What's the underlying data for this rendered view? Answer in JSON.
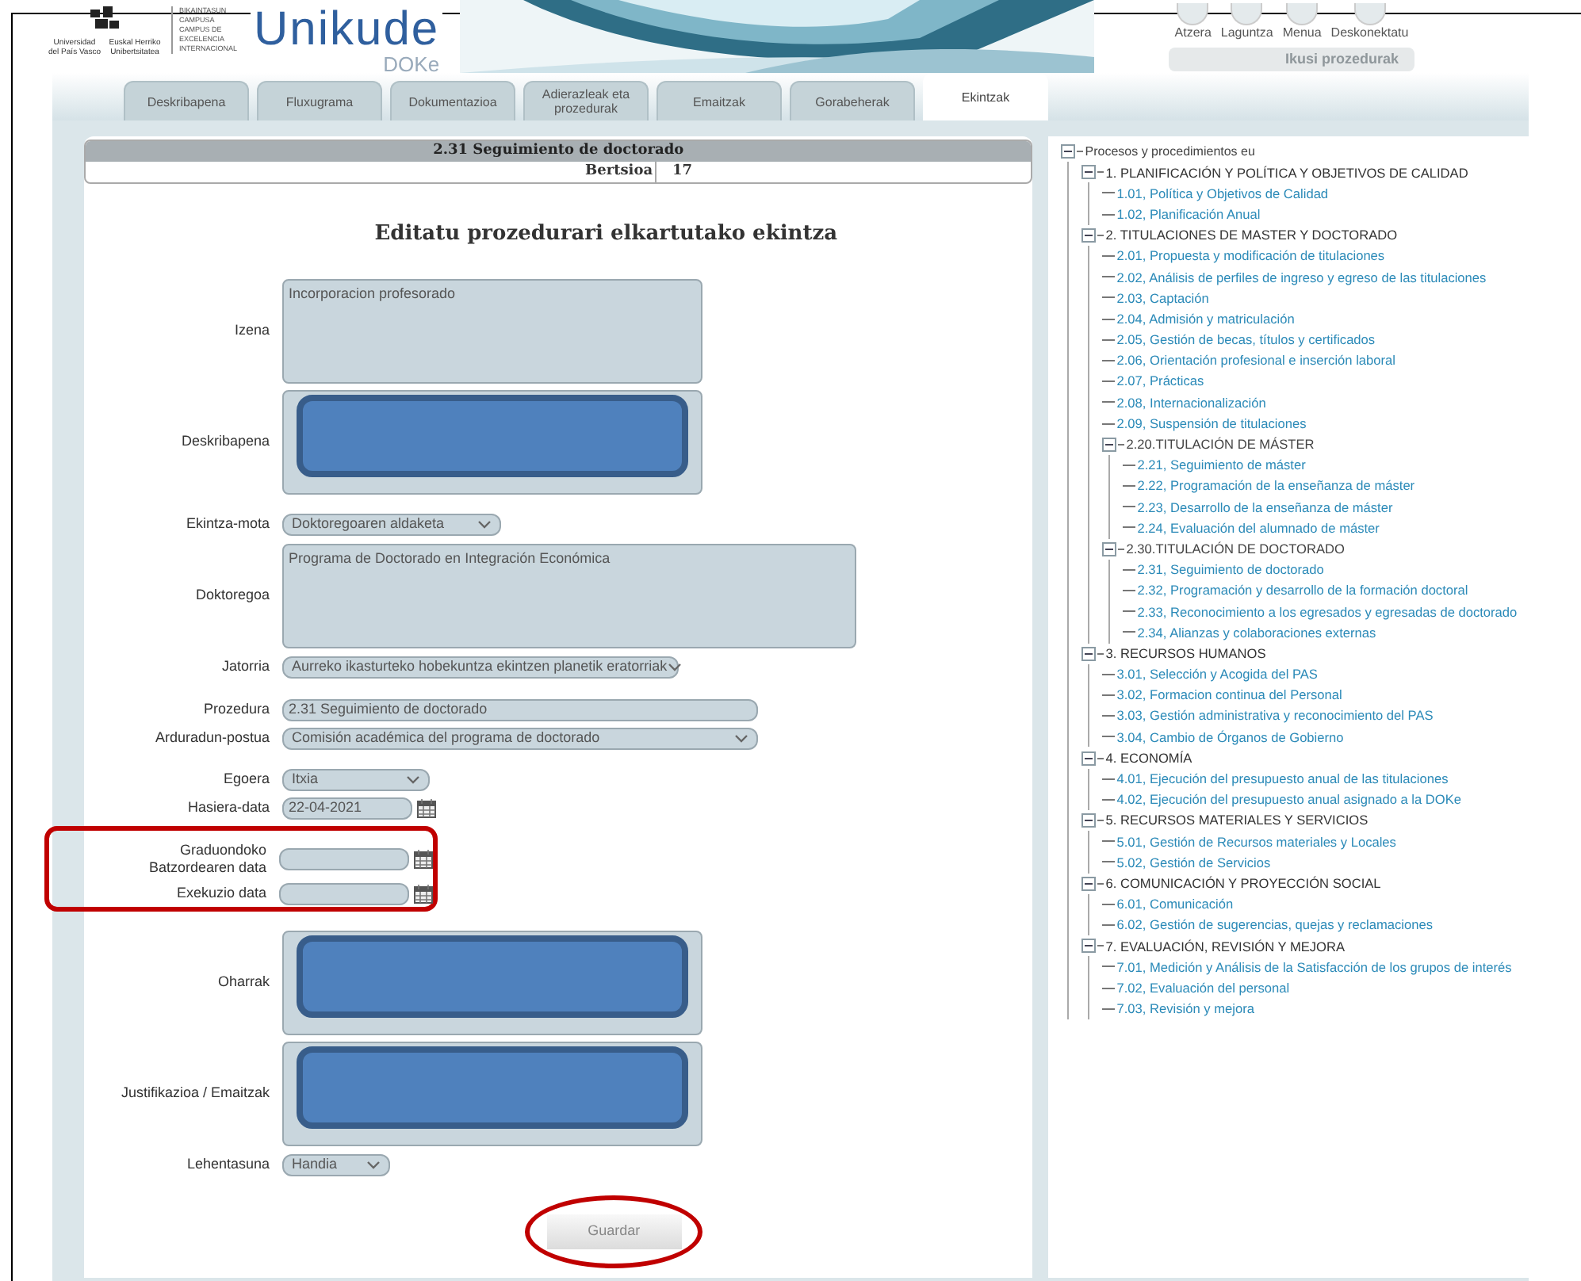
{
  "header": {
    "university": [
      "Universidad del País Vasco",
      "Euskal Herriko Unibertsitatea"
    ],
    "campus": [
      "BIKAINTASUN CAMPUSA",
      "CAMPUS DE EXCELENCIA INTERNACIONAL"
    ],
    "app_name": "Unikude",
    "app_sub": "DOKe",
    "nav": [
      {
        "label": "Atzera"
      },
      {
        "label": "Laguntza"
      },
      {
        "label": "Menua"
      },
      {
        "label": "Deskonektatu"
      }
    ],
    "procedures_button": "Ikusi prozedurak"
  },
  "tabs": [
    {
      "label": "Deskribapena",
      "selected": false
    },
    {
      "label": "Fluxugrama",
      "selected": false
    },
    {
      "label": "Dokumentazioa",
      "selected": false
    },
    {
      "label": "Adierazleak eta prozedurak",
      "selected": false
    },
    {
      "label": "Emaitzak",
      "selected": false
    },
    {
      "label": "Gorabeherak",
      "selected": false
    },
    {
      "label": "Ekintzak",
      "selected": true
    }
  ],
  "procedure_header": {
    "title": "2.31 Seguimiento de doctorado",
    "version_label": "Bertsioa",
    "version": "17"
  },
  "form": {
    "title": "Editatu prozedurari elkartutako ekintza",
    "fields": [
      {
        "label": "Izena",
        "kind": "textarea",
        "value": "Incorporacion profesorado",
        "redacted": false
      },
      {
        "label": "Deskribapena",
        "kind": "textarea",
        "redacted": true
      },
      {
        "label": "Ekintza-mota",
        "kind": "select",
        "value": "Doktoregoaren aldaketa"
      },
      {
        "label": "Doktoregoa",
        "kind": "textarea",
        "value": "Programa de Doctorado en Integración Económica",
        "redacted": false
      },
      {
        "label": "Jatorria",
        "kind": "select",
        "value": "Aurreko ikasturteko hobekuntza ekintzen planetik eratorriak"
      },
      {
        "label": "Prozedura",
        "kind": "input",
        "value": "2.31 Seguimiento de doctorado"
      },
      {
        "label": "Arduradun-postua",
        "kind": "select",
        "value": "Comisión académica del programa de doctorado"
      },
      {
        "label": "Egoera",
        "kind": "select",
        "value": "Itxia"
      },
      {
        "label": "Hasiera-data",
        "kind": "date",
        "value": "22-04-2021",
        "highlighted": false
      },
      {
        "label": "Graduondoko Batzordearen data",
        "kind": "date",
        "highlighted": true
      },
      {
        "label": "Exekuzio data",
        "kind": "date",
        "highlighted": true
      },
      {
        "label": "Oharrak",
        "kind": "textarea",
        "redacted": true
      },
      {
        "label": "Justifikazioa / Emaitzak",
        "kind": "textarea",
        "redacted": true
      },
      {
        "label": "Lehentasuna",
        "kind": "select",
        "value": "Handia"
      }
    ],
    "save_button": "Guardar"
  },
  "tree": {
    "label": "Procesos y procedimientos eu",
    "expanded": true,
    "children": [
      {
        "label": "1. PLANIFICACIÓN Y POLÍTICA Y OBJETIVOS DE CALIDAD",
        "expanded": true,
        "children": [
          {
            "label": "1.01, Política y Objetivos de Calidad"
          },
          {
            "label": "1.02, Planificación Anual"
          }
        ]
      },
      {
        "label": "2. TITULACIONES DE MASTER Y DOCTORADO",
        "expanded": true,
        "children": [
          {
            "label": "2.01, Propuesta y modificación de titulaciones"
          },
          {
            "label": "2.02, Análisis de perfiles de ingreso y egreso de las titulaciones"
          },
          {
            "label": "2.03, Captación"
          },
          {
            "label": "2.04, Admisión y matriculación"
          },
          {
            "label": "2.05, Gestión de becas, títulos y certificados"
          },
          {
            "label": "2.06, Orientación profesional e inserción laboral"
          },
          {
            "label": "2.07, Prácticas"
          },
          {
            "label": "2.08, Internacionalización"
          },
          {
            "label": "2.09, Suspensión de titulaciones"
          },
          {
            "label": "2.20.TITULACIÓN DE MÁSTER",
            "expanded": true,
            "children": [
              {
                "label": "2.21, Seguimiento de máster"
              },
              {
                "label": "2.22, Programación de la enseñanza de máster"
              },
              {
                "label": "2.23, Desarrollo de la enseñanza de máster"
              },
              {
                "label": "2.24, Evaluación del alumnado de máster"
              }
            ]
          },
          {
            "label": "2.30.TITULACIÓN DE DOCTORADO",
            "expanded": true,
            "children": [
              {
                "label": "2.31, Seguimiento de doctorado"
              },
              {
                "label": "2.32, Programación y desarrollo de la formación doctoral"
              },
              {
                "label": "2.33, Reconocimiento a los egresados y egresadas de doctorado"
              },
              {
                "label": "2.34, Alianzas y colaboraciones externas"
              }
            ]
          }
        ]
      },
      {
        "label": "3. RECURSOS HUMANOS",
        "expanded": true,
        "children": [
          {
            "label": "3.01, Selección y Acogida del PAS"
          },
          {
            "label": "3.02, Formacion continua del Personal"
          },
          {
            "label": "3.03, Gestión administrativa y reconocimiento del PAS"
          },
          {
            "label": "3.04, Cambio de Órganos de Gobierno"
          }
        ]
      },
      {
        "label": "4. ECONOMÍA",
        "expanded": true,
        "children": [
          {
            "label": "4.01, Ejecución del presupuesto anual de las titulaciones"
          },
          {
            "label": "4.02, Ejecución del presupuesto anual asignado a la DOKe"
          }
        ]
      },
      {
        "label": "5. RECURSOS MATERIALES Y SERVICIOS",
        "expanded": true,
        "children": [
          {
            "label": "5.01, Gestión de Recursos materiales y Locales"
          },
          {
            "label": "5.02, Gestión de Servicios"
          }
        ]
      },
      {
        "label": "6. COMUNICACIÓN Y PROYECCIÓN SOCIAL",
        "expanded": true,
        "children": [
          {
            "label": "6.01, Comunicación"
          },
          {
            "label": "6.02, Gestión de sugerencias, quejas y reclamaciones"
          }
        ]
      },
      {
        "label": "7. EVALUACIÓN, REVISIÓN Y MEJORA",
        "expanded": true,
        "children": [
          {
            "label": "7.01, Medición y Análisis de la Satisfacción de los grupos de interés"
          },
          {
            "label": "7.02, Evaluación del personal"
          },
          {
            "label": "7.03, Revisión y mejora"
          }
        ]
      }
    ]
  }
}
